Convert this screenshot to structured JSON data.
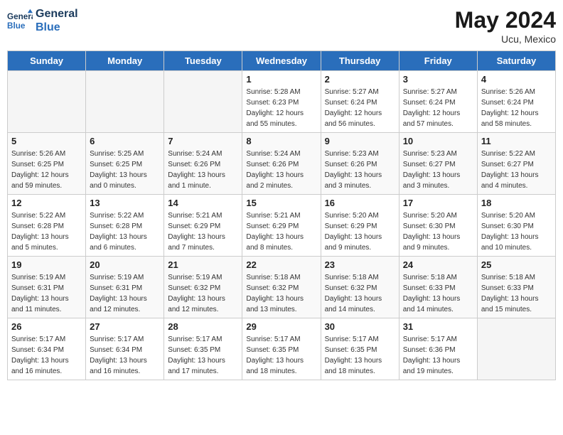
{
  "header": {
    "logo_general": "General",
    "logo_blue": "Blue",
    "month_title": "May 2024",
    "location": "Ucu, Mexico"
  },
  "weekdays": [
    "Sunday",
    "Monday",
    "Tuesday",
    "Wednesday",
    "Thursday",
    "Friday",
    "Saturday"
  ],
  "weeks": [
    [
      {
        "day": "",
        "info": ""
      },
      {
        "day": "",
        "info": ""
      },
      {
        "day": "",
        "info": ""
      },
      {
        "day": "1",
        "info": "Sunrise: 5:28 AM\nSunset: 6:23 PM\nDaylight: 12 hours\nand 55 minutes."
      },
      {
        "day": "2",
        "info": "Sunrise: 5:27 AM\nSunset: 6:24 PM\nDaylight: 12 hours\nand 56 minutes."
      },
      {
        "day": "3",
        "info": "Sunrise: 5:27 AM\nSunset: 6:24 PM\nDaylight: 12 hours\nand 57 minutes."
      },
      {
        "day": "4",
        "info": "Sunrise: 5:26 AM\nSunset: 6:24 PM\nDaylight: 12 hours\nand 58 minutes."
      }
    ],
    [
      {
        "day": "5",
        "info": "Sunrise: 5:26 AM\nSunset: 6:25 PM\nDaylight: 12 hours\nand 59 minutes."
      },
      {
        "day": "6",
        "info": "Sunrise: 5:25 AM\nSunset: 6:25 PM\nDaylight: 13 hours\nand 0 minutes."
      },
      {
        "day": "7",
        "info": "Sunrise: 5:24 AM\nSunset: 6:26 PM\nDaylight: 13 hours\nand 1 minute."
      },
      {
        "day": "8",
        "info": "Sunrise: 5:24 AM\nSunset: 6:26 PM\nDaylight: 13 hours\nand 2 minutes."
      },
      {
        "day": "9",
        "info": "Sunrise: 5:23 AM\nSunset: 6:26 PM\nDaylight: 13 hours\nand 3 minutes."
      },
      {
        "day": "10",
        "info": "Sunrise: 5:23 AM\nSunset: 6:27 PM\nDaylight: 13 hours\nand 3 minutes."
      },
      {
        "day": "11",
        "info": "Sunrise: 5:22 AM\nSunset: 6:27 PM\nDaylight: 13 hours\nand 4 minutes."
      }
    ],
    [
      {
        "day": "12",
        "info": "Sunrise: 5:22 AM\nSunset: 6:28 PM\nDaylight: 13 hours\nand 5 minutes."
      },
      {
        "day": "13",
        "info": "Sunrise: 5:22 AM\nSunset: 6:28 PM\nDaylight: 13 hours\nand 6 minutes."
      },
      {
        "day": "14",
        "info": "Sunrise: 5:21 AM\nSunset: 6:29 PM\nDaylight: 13 hours\nand 7 minutes."
      },
      {
        "day": "15",
        "info": "Sunrise: 5:21 AM\nSunset: 6:29 PM\nDaylight: 13 hours\nand 8 minutes."
      },
      {
        "day": "16",
        "info": "Sunrise: 5:20 AM\nSunset: 6:29 PM\nDaylight: 13 hours\nand 9 minutes."
      },
      {
        "day": "17",
        "info": "Sunrise: 5:20 AM\nSunset: 6:30 PM\nDaylight: 13 hours\nand 9 minutes."
      },
      {
        "day": "18",
        "info": "Sunrise: 5:20 AM\nSunset: 6:30 PM\nDaylight: 13 hours\nand 10 minutes."
      }
    ],
    [
      {
        "day": "19",
        "info": "Sunrise: 5:19 AM\nSunset: 6:31 PM\nDaylight: 13 hours\nand 11 minutes."
      },
      {
        "day": "20",
        "info": "Sunrise: 5:19 AM\nSunset: 6:31 PM\nDaylight: 13 hours\nand 12 minutes."
      },
      {
        "day": "21",
        "info": "Sunrise: 5:19 AM\nSunset: 6:32 PM\nDaylight: 13 hours\nand 12 minutes."
      },
      {
        "day": "22",
        "info": "Sunrise: 5:18 AM\nSunset: 6:32 PM\nDaylight: 13 hours\nand 13 minutes."
      },
      {
        "day": "23",
        "info": "Sunrise: 5:18 AM\nSunset: 6:32 PM\nDaylight: 13 hours\nand 14 minutes."
      },
      {
        "day": "24",
        "info": "Sunrise: 5:18 AM\nSunset: 6:33 PM\nDaylight: 13 hours\nand 14 minutes."
      },
      {
        "day": "25",
        "info": "Sunrise: 5:18 AM\nSunset: 6:33 PM\nDaylight: 13 hours\nand 15 minutes."
      }
    ],
    [
      {
        "day": "26",
        "info": "Sunrise: 5:17 AM\nSunset: 6:34 PM\nDaylight: 13 hours\nand 16 minutes."
      },
      {
        "day": "27",
        "info": "Sunrise: 5:17 AM\nSunset: 6:34 PM\nDaylight: 13 hours\nand 16 minutes."
      },
      {
        "day": "28",
        "info": "Sunrise: 5:17 AM\nSunset: 6:35 PM\nDaylight: 13 hours\nand 17 minutes."
      },
      {
        "day": "29",
        "info": "Sunrise: 5:17 AM\nSunset: 6:35 PM\nDaylight: 13 hours\nand 18 minutes."
      },
      {
        "day": "30",
        "info": "Sunrise: 5:17 AM\nSunset: 6:35 PM\nDaylight: 13 hours\nand 18 minutes."
      },
      {
        "day": "31",
        "info": "Sunrise: 5:17 AM\nSunset: 6:36 PM\nDaylight: 13 hours\nand 19 minutes."
      },
      {
        "day": "",
        "info": ""
      }
    ]
  ]
}
